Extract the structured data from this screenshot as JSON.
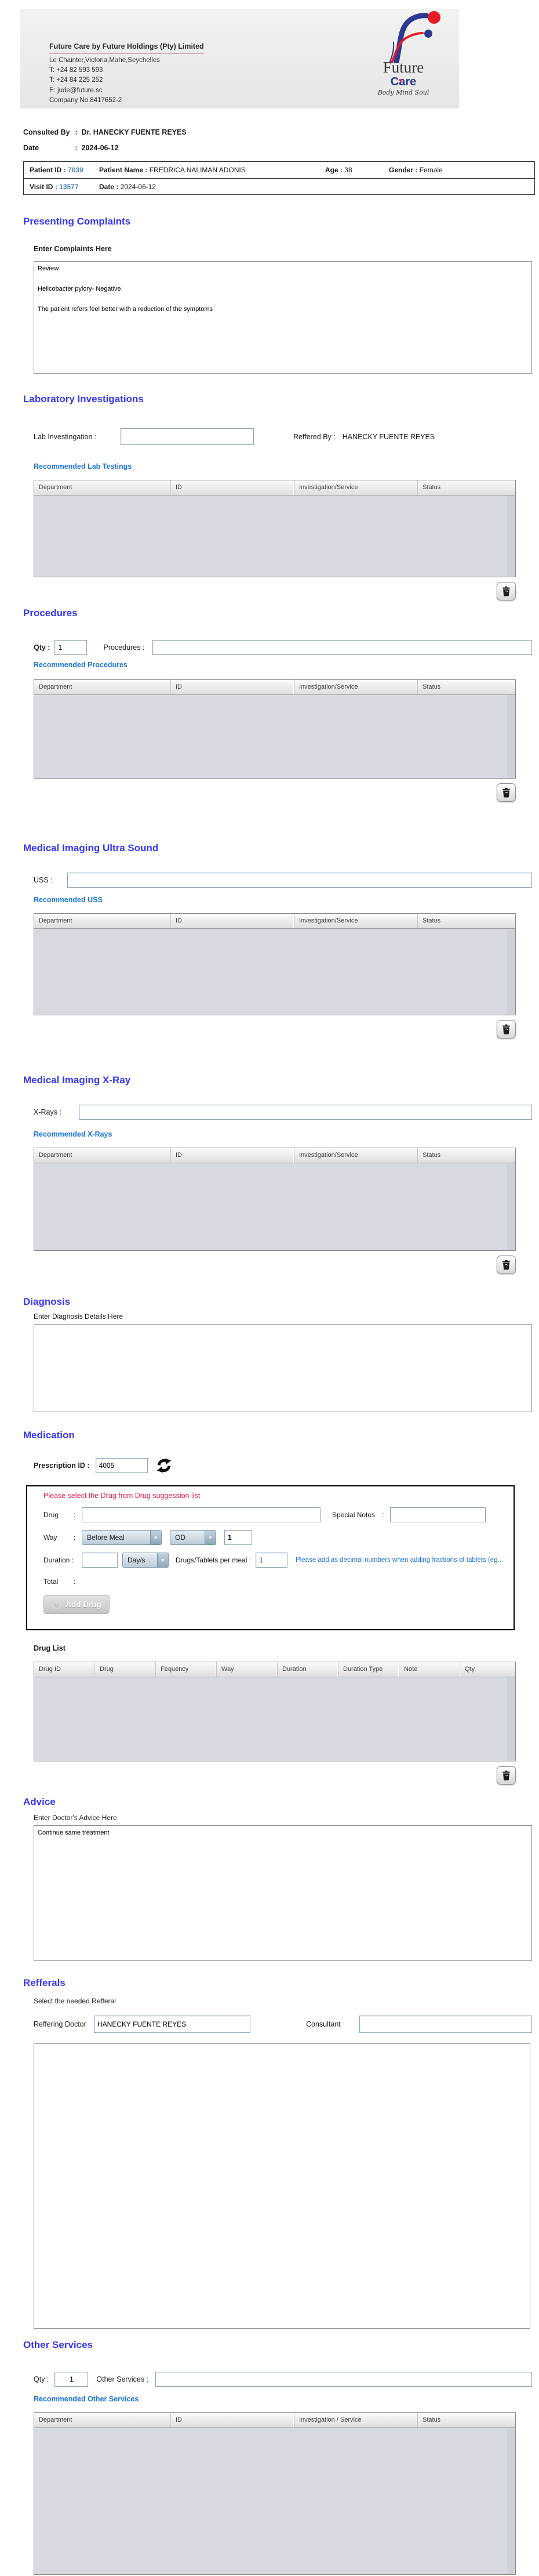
{
  "ui": {
    "colon": ":"
  },
  "icons": {
    "dropdown_arrow": "▼",
    "heart": "♥",
    "add_plus": "+"
  },
  "colors": {
    "section_heading_blue": "#3737EE",
    "recommended_link_blue": "#1B74D8",
    "id_value_blue": "#4F81BD",
    "warning_red": "#E01C4E",
    "table_body_gray": "#D6D9E0",
    "logo_blue": "#2B3990",
    "logo_red": "#E31E24"
  },
  "header": {
    "company_title": "Future Care by Future Holdings (Pty) Limited",
    "address": "Le Chainter,Victoria,Mahe,Seychelles",
    "phone1": "T: +24  82 593 593",
    "phone2": "T: +24  84 225 252",
    "email": "E: jude@future.sc",
    "company_no": "Company No.8417652-2",
    "logo": {
      "word1": "Future",
      "word2": "Care",
      "tagline": "Body Mind Soul"
    }
  },
  "consultation": {
    "consulted_by_label": "Consulted By",
    "consulted_by": "Dr.  HANECKY FUENTE REYES",
    "date_label": "Date",
    "date": "2024-06-12"
  },
  "patient": {
    "patient_id_label": "Patient ID",
    "patient_id": "7039",
    "patient_name_label": "Patient Name",
    "patient_name": "FREDRICA NALIMAN ADONIS",
    "age_label": "Age",
    "age": "38",
    "gender_label": "Gender",
    "gender": "Female",
    "visit_id_label": "Visit ID",
    "visit_id": "13577",
    "visit_date_label": "Date",
    "visit_date": "2024-06-12"
  },
  "presenting_complaints": {
    "heading": "Presenting Complaints",
    "label": "Enter Complaints Here",
    "text": "Review\n\nHelicobacter pylory- Negative\n\nThe patient refers feel better with a reduction of the symptoms"
  },
  "laboratory": {
    "heading": "Laboratory  Investigations",
    "input_label": "Lab Investingation :",
    "input_value": "",
    "reffered_by_label": "Reffered By :",
    "reffered_by": "HANECKY FUENTE REYES",
    "recommended_label": "Recommended Lab Testings",
    "table_headers": [
      "Department",
      "ID",
      "Investigation/Service",
      "Status"
    ],
    "rows": []
  },
  "procedures": {
    "heading": "Procedures",
    "qty_label": "Qty :",
    "qty_value": "1",
    "input_label": "Procedures :",
    "input_value": "",
    "recommended_label": "Recommended Procedures",
    "table_headers": [
      "Department",
      "ID",
      "Investigation/Service",
      "Status"
    ],
    "rows": []
  },
  "ultrasound": {
    "heading": "Medical Imaging Ultra Sound",
    "input_label": "USS :",
    "input_value": "",
    "recommended_label": "Recommended USS",
    "table_headers": [
      "Department",
      "ID",
      "Investigation/Service",
      "Status"
    ],
    "rows": []
  },
  "xray": {
    "heading": "Medical Imaging X-Ray",
    "input_label": "X-Rays :",
    "input_value": "",
    "recommended_label": "Recommended X-Rays",
    "table_headers": [
      "Department",
      "ID",
      "Investigation/Service",
      "Status"
    ],
    "rows": []
  },
  "diagnosis": {
    "heading": "Diagnosis",
    "label": "Enter Diagnosis Details Here",
    "text": ""
  },
  "medication": {
    "heading": "Medication",
    "prescription_id_label": "Prescription ID :",
    "prescription_id": "4005",
    "warning": "Please select the Drug from Drug suggession list",
    "drug_label": "Drug",
    "drug_value": "",
    "special_notes_label": "Special Notes",
    "special_notes_value": "",
    "way_label": "Way",
    "way_meal_option": "Before Meal",
    "way_freq_option": "OD",
    "way_qty": "1",
    "duration_label": "Duration :",
    "duration_value": "",
    "duration_type_option": "Day/s",
    "per_meal_label": "Drugs/Tablets per meal :",
    "per_meal_value": "1",
    "per_meal_note": "Please add as decimal numbers when adding fractions of tablets (eg...",
    "total_label": "Total",
    "add_drug_label": "Add Drug",
    "drug_list_label": "Drug List",
    "table_headers": [
      "Drug ID",
      "Drug",
      "Fequency",
      "Way",
      "Duration",
      "Duration Type",
      "Note",
      "Qty"
    ],
    "rows": []
  },
  "advice": {
    "heading": "Advice",
    "label": "Enter Doctor's Advice Here",
    "text": "Continue same treatment"
  },
  "referrals": {
    "heading": "Refferals",
    "label": "Select the needed Refferal",
    "reffering_doctor_label": "Reffering Doctor",
    "reffering_doctor": "HANECKY FUENTE REYES",
    "consultant_label": "Consultant",
    "consultant": ""
  },
  "other_services": {
    "heading": "Other Services",
    "qty_label": "Qty :",
    "qty_value": "1",
    "input_label": "Other Services :",
    "input_value": "",
    "recommended_label": "Recommended Other Services",
    "table_headers": [
      "Department",
      "ID",
      "Investigation / Service",
      "Status"
    ],
    "rows": []
  }
}
